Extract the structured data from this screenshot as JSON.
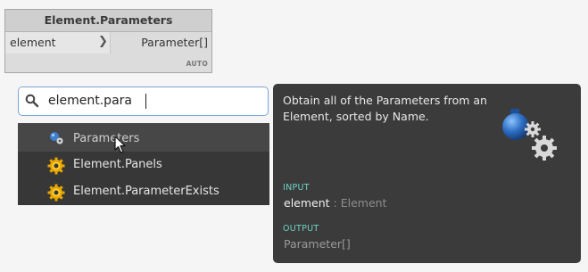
{
  "node": {
    "title": "Element.Parameters",
    "input_port": "element",
    "output_port": "Parameter[]",
    "lacing": "AUTO"
  },
  "search": {
    "query": "element.para"
  },
  "results": [
    {
      "label": "Parameters",
      "icon": "parameters-node-icon"
    },
    {
      "label": "Element.Panels",
      "icon": "gear-icon"
    },
    {
      "label": "Element.ParameterExists",
      "icon": "gear-icon"
    }
  ],
  "tooltip": {
    "description": "Obtain all of the Parameters from an Element, sorted by Name.",
    "input_heading": "INPUT",
    "input_name": "element",
    "input_separator": " : ",
    "input_type": "Element",
    "output_heading": "OUTPUT",
    "output_type": "Parameter[]"
  },
  "colors": {
    "accent_teal": "#6fd3c3",
    "search_border": "#7aa7d6",
    "panel_dark": "#3b3b3b"
  }
}
